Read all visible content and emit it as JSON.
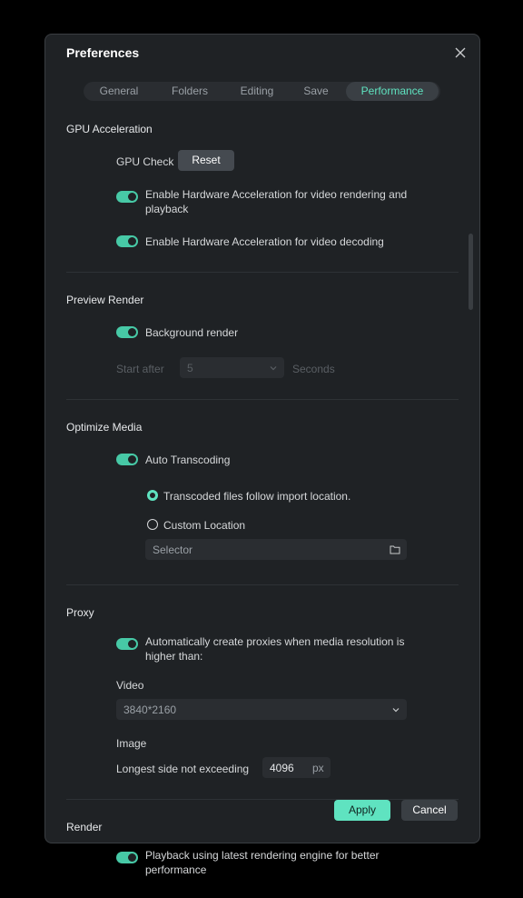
{
  "dialog": {
    "title": "Preferences"
  },
  "tabs": [
    {
      "label": "General"
    },
    {
      "label": "Folders"
    },
    {
      "label": "Editing"
    },
    {
      "label": "Save"
    },
    {
      "label": "Performance",
      "active": true
    }
  ],
  "gpu": {
    "heading": "GPU Acceleration",
    "check_label": "GPU Check",
    "reset_label": "Reset",
    "hw_render_line1": "Enable Hardware Acceleration for video rendering and",
    "hw_render_line2": "playback",
    "hw_render_on": true,
    "hw_decode": "Enable Hardware Acceleration for video decoding",
    "hw_decode_on": true
  },
  "preview": {
    "heading": "Preview Render",
    "background_render": "Background render",
    "background_render_on": true,
    "start_after_label": "Start after",
    "start_after_value": "5",
    "seconds_label": "Seconds"
  },
  "optimize": {
    "heading": "Optimize Media",
    "auto_transcoding": "Auto Transcoding",
    "auto_transcoding_on": true,
    "radio_follow": "Transcoded files follow import location.",
    "radio_custom": "Custom Location",
    "selector_placeholder": "Selector"
  },
  "proxy": {
    "heading": "Proxy",
    "auto_proxy_line1": "Automatically create proxies when media resolution is",
    "auto_proxy_line2": "higher than:",
    "auto_proxy_on": true,
    "video_label": "Video",
    "video_value": "3840*2160",
    "image_label": "Image",
    "longest_side_label": "Longest side not exceeding",
    "longest_side_value": "4096",
    "unit": "px"
  },
  "render": {
    "heading": "Render",
    "playback_line1": "Playback using latest rendering engine for better",
    "playback_line2": "performance",
    "playback_on": true
  },
  "footer": {
    "apply_label": "Apply",
    "cancel_label": "Cancel"
  },
  "colors": {
    "accent": "#5fe3c0",
    "toggle": "#47c9a6",
    "dialog_bg": "#1f2225"
  }
}
